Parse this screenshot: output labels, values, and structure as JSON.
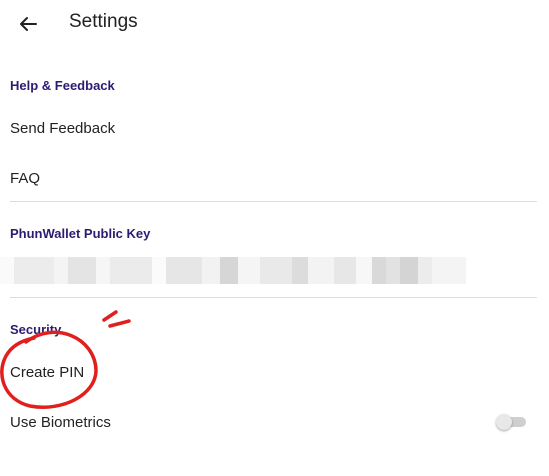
{
  "header": {
    "title": "Settings",
    "back_icon": "arrow-left-icon"
  },
  "sections": {
    "help": {
      "title": "Help & Feedback",
      "items": [
        "Send Feedback",
        "FAQ"
      ]
    },
    "public_key": {
      "title": "PhunWallet Public Key",
      "value_state": "blurred"
    },
    "security": {
      "title": "Security",
      "items": [
        "Create PIN",
        "Use Biometrics"
      ]
    }
  },
  "toggles": {
    "use_biometrics": false
  },
  "colors": {
    "section_header": "#2d1b72",
    "annotation": "#e0201e",
    "divider": "#dcdcdc"
  }
}
